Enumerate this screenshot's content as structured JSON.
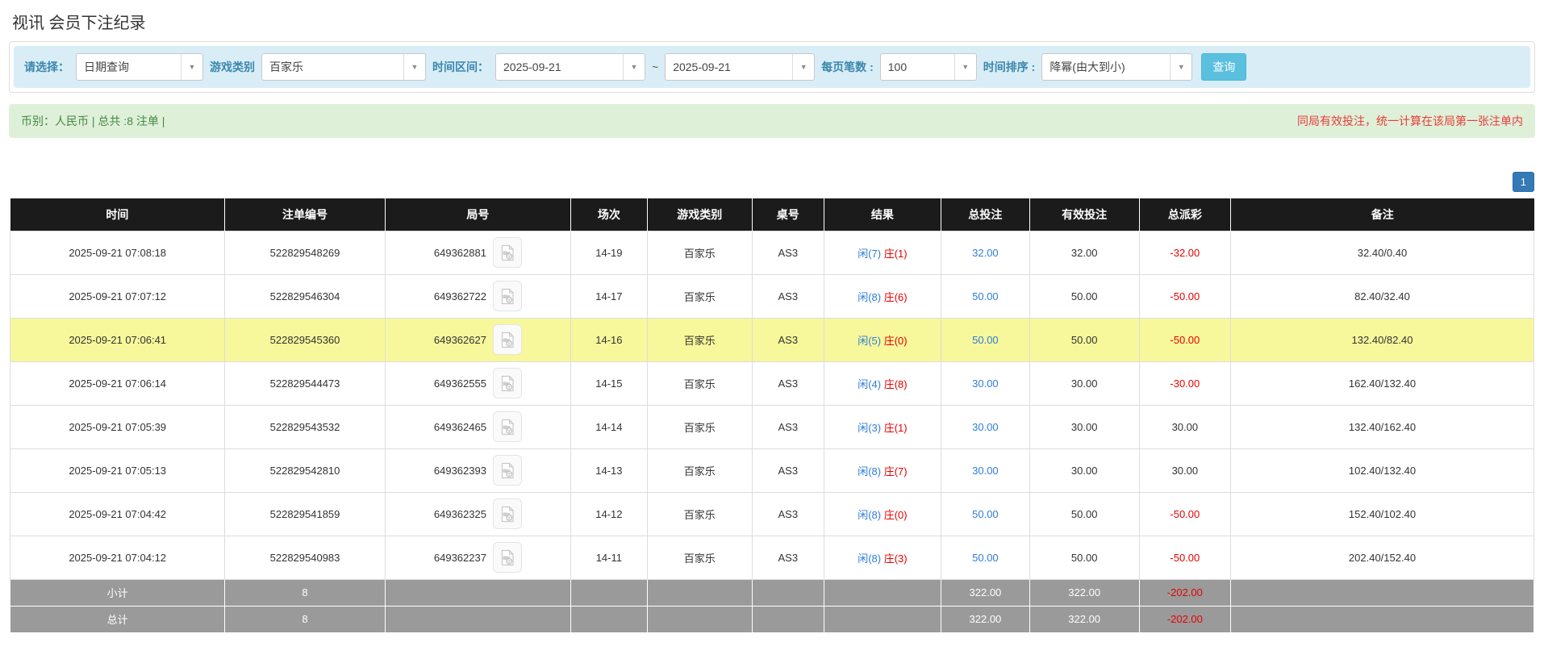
{
  "page": {
    "title": "视讯 会员下注纪录"
  },
  "filters": {
    "select_label": "请选择：",
    "select_value": "日期查询",
    "game_label": "游戏类别",
    "game_value": "百家乐",
    "range_label": "时间区间：",
    "date_from": "2025-09-21",
    "tilde": "~",
    "date_to": "2025-09-21",
    "per_page_label": "每页笔数 :",
    "per_page_value": "100",
    "sort_label": "时间排序 :",
    "sort_value": "降幂(由大到小)",
    "search_button": "查询"
  },
  "info_bar": {
    "summary": "币别：人民币 | 总共 :8 注单 |",
    "note": "同局有效投注，统一计算在该局第一张注单内"
  },
  "pagination": {
    "current": "1"
  },
  "icons": {
    "dropdown": "chevron-down-icon",
    "round_media": "video-file-icon",
    "dropdown_glyph": "▼"
  },
  "colors": {
    "filter_bar_bg": "#d9edf7",
    "filter_label": "#3a87ad",
    "search_button_bg": "#5bc0de",
    "info_bar_bg": "#dff0d8",
    "info_text": "#468847",
    "note_red": "#e73c3c",
    "header_bg": "#1b1b1b",
    "highlight_row": "#f7f79b",
    "amount_blue": "#2f7ed8",
    "amount_red": "#e60000",
    "total_row_bg": "#9a9a9a",
    "pagination_bg": "#337ab7"
  },
  "table": {
    "headers": [
      "时间",
      "注单编号",
      "局号",
      "场次",
      "游戏类别",
      "桌号",
      "结果",
      "总投注",
      "有效投注",
      "总派彩",
      "备注"
    ],
    "rows": [
      {
        "time": "2025-09-21 07:08:18",
        "bet_id": "522829548269",
        "round_id": "649362881",
        "session": "14-19",
        "game": "百家乐",
        "table_no": "AS3",
        "result_player": "闲(7)",
        "result_banker": "庄(1)",
        "total_bet": "32.00",
        "valid_bet": "32.00",
        "payout": "-32.00",
        "remark": "32.40/0.40",
        "highlight": false
      },
      {
        "time": "2025-09-21 07:07:12",
        "bet_id": "522829546304",
        "round_id": "649362722",
        "session": "14-17",
        "game": "百家乐",
        "table_no": "AS3",
        "result_player": "闲(8)",
        "result_banker": "庄(6)",
        "total_bet": "50.00",
        "valid_bet": "50.00",
        "payout": "-50.00",
        "remark": "82.40/32.40",
        "highlight": false
      },
      {
        "time": "2025-09-21 07:06:41",
        "bet_id": "522829545360",
        "round_id": "649362627",
        "session": "14-16",
        "game": "百家乐",
        "table_no": "AS3",
        "result_player": "闲(5)",
        "result_banker": "庄(0)",
        "total_bet": "50.00",
        "valid_bet": "50.00",
        "payout": "-50.00",
        "remark": "132.40/82.40",
        "highlight": true
      },
      {
        "time": "2025-09-21 07:06:14",
        "bet_id": "522829544473",
        "round_id": "649362555",
        "session": "14-15",
        "game": "百家乐",
        "table_no": "AS3",
        "result_player": "闲(4)",
        "result_banker": "庄(8)",
        "total_bet": "30.00",
        "valid_bet": "30.00",
        "payout": "-30.00",
        "remark": "162.40/132.40",
        "highlight": false
      },
      {
        "time": "2025-09-21 07:05:39",
        "bet_id": "522829543532",
        "round_id": "649362465",
        "session": "14-14",
        "game": "百家乐",
        "table_no": "AS3",
        "result_player": "闲(3)",
        "result_banker": "庄(1)",
        "total_bet": "30.00",
        "valid_bet": "30.00",
        "payout": "30.00",
        "remark": "132.40/162.40",
        "highlight": false
      },
      {
        "time": "2025-09-21 07:05:13",
        "bet_id": "522829542810",
        "round_id": "649362393",
        "session": "14-13",
        "game": "百家乐",
        "table_no": "AS3",
        "result_player": "闲(8)",
        "result_banker": "庄(7)",
        "total_bet": "30.00",
        "valid_bet": "30.00",
        "payout": "30.00",
        "remark": "102.40/132.40",
        "highlight": false
      },
      {
        "time": "2025-09-21 07:04:42",
        "bet_id": "522829541859",
        "round_id": "649362325",
        "session": "14-12",
        "game": "百家乐",
        "table_no": "AS3",
        "result_player": "闲(8)",
        "result_banker": "庄(0)",
        "total_bet": "50.00",
        "valid_bet": "50.00",
        "payout": "-50.00",
        "remark": "152.40/102.40",
        "highlight": false
      },
      {
        "time": "2025-09-21 07:04:12",
        "bet_id": "522829540983",
        "round_id": "649362237",
        "session": "14-11",
        "game": "百家乐",
        "table_no": "AS3",
        "result_player": "闲(8)",
        "result_banker": "庄(3)",
        "total_bet": "50.00",
        "valid_bet": "50.00",
        "payout": "-50.00",
        "remark": "202.40/152.40",
        "highlight": false
      }
    ],
    "subtotal": {
      "label": "小计",
      "count": "8",
      "total_bet": "322.00",
      "valid_bet": "322.00",
      "payout": "-202.00"
    },
    "total": {
      "label": "总计",
      "count": "8",
      "total_bet": "322.00",
      "valid_bet": "322.00",
      "payout": "-202.00"
    }
  }
}
